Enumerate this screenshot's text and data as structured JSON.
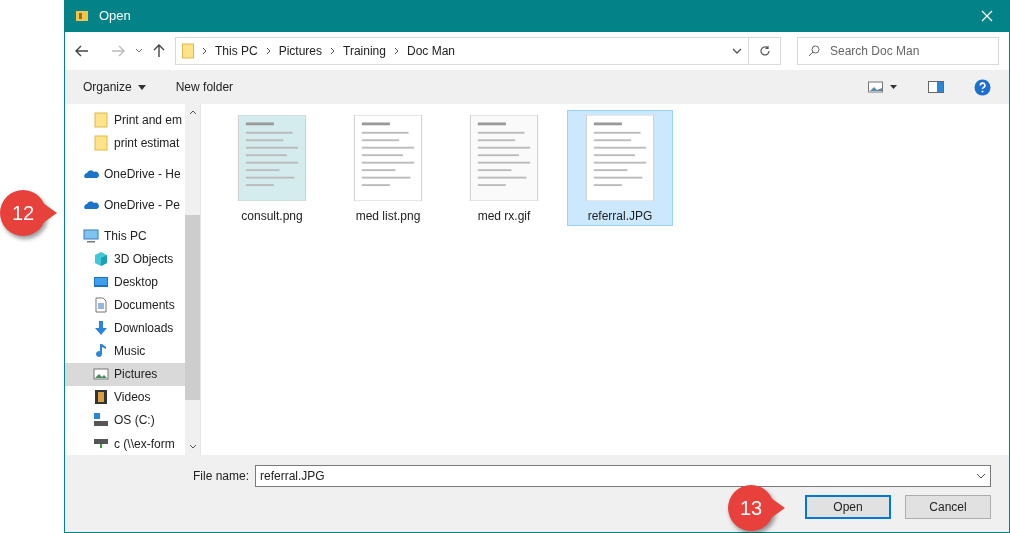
{
  "window": {
    "title": "Open"
  },
  "address": {
    "crumbs": [
      "This PC",
      "Pictures",
      "Training",
      "Doc Man"
    ]
  },
  "search": {
    "placeholder": "Search Doc Man"
  },
  "toolbar": {
    "organize": "Organize",
    "new_folder": "New folder"
  },
  "sidebar": {
    "items": [
      {
        "label": "Print and em",
        "kind": "folder",
        "selected": false
      },
      {
        "label": "print estimat",
        "kind": "folder",
        "selected": false
      },
      {
        "label": "OneDrive - He",
        "kind": "cloud",
        "selected": false
      },
      {
        "label": "OneDrive - Pe",
        "kind": "cloud",
        "selected": false
      },
      {
        "label": "This PC",
        "kind": "pc",
        "selected": false
      },
      {
        "label": "3D Objects",
        "kind": "cube",
        "selected": false
      },
      {
        "label": "Desktop",
        "kind": "desktop",
        "selected": false
      },
      {
        "label": "Documents",
        "kind": "documents",
        "selected": false
      },
      {
        "label": "Downloads",
        "kind": "downloads",
        "selected": false
      },
      {
        "label": "Music",
        "kind": "music",
        "selected": false
      },
      {
        "label": "Pictures",
        "kind": "pictures",
        "selected": true
      },
      {
        "label": "Videos",
        "kind": "videos",
        "selected": false
      },
      {
        "label": "OS (C:)",
        "kind": "drive",
        "selected": false
      },
      {
        "label": "c (\\\\ex-form",
        "kind": "netdrive",
        "selected": false
      }
    ]
  },
  "files": [
    {
      "name": "consult.png",
      "kind": "picture",
      "selected": false
    },
    {
      "name": "med list.png",
      "kind": "picture",
      "selected": false
    },
    {
      "name": "med rx.gif",
      "kind": "picture",
      "selected": false
    },
    {
      "name": "referral.JPG",
      "kind": "picture",
      "selected": true
    }
  ],
  "file_name": {
    "label": "File name:",
    "value": "referral.JPG"
  },
  "buttons": {
    "open": "Open",
    "cancel": "Cancel"
  },
  "callouts": [
    {
      "number": "12"
    },
    {
      "number": "13"
    }
  ]
}
